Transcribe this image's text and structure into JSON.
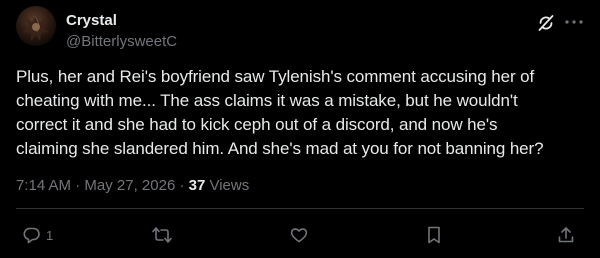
{
  "author": {
    "display_name": "Crystal",
    "handle": "@BitterlysweetC"
  },
  "post": {
    "text": "Plus, her and Rei's boyfriend saw Tylenish's comment accusing her of\ncheating with me... The ass claims it was a mistake, but he wouldn't\ncorrect it and she had to kick ceph out of a discord, and now he's\nclaiming she slandered him. And she's mad at you for not banning her?"
  },
  "meta": {
    "time": "7:14 AM",
    "separator": " · ",
    "date": "May 27, 2026",
    "separator2": " · ",
    "views_count": "37",
    "views_label": " Views"
  },
  "actions": {
    "reply_count": "1"
  },
  "colors": {
    "background": "#000000",
    "text_primary": "#e7e9ea",
    "text_secondary": "#71767b",
    "divider": "#2f3336"
  },
  "icons": [
    "grok-icon",
    "more-icon",
    "reply-icon",
    "repost-icon",
    "like-icon",
    "bookmark-icon",
    "share-icon"
  ]
}
